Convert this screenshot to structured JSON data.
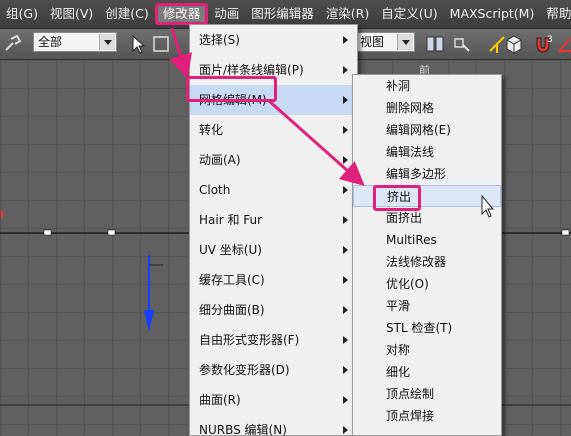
{
  "menubar": {
    "items": [
      {
        "label": "组(G)"
      },
      {
        "label": "视图(V)"
      },
      {
        "label": "创建(C)"
      },
      {
        "label": "修改器"
      },
      {
        "label": "动画"
      },
      {
        "label": "图形编辑器"
      },
      {
        "label": "渲染(R)"
      },
      {
        "label": "自定义(U)"
      },
      {
        "label": "MAXScript(M)"
      },
      {
        "label": "帮助"
      }
    ]
  },
  "toolbar": {
    "selection_filter": "全部",
    "view_combo": "视图"
  },
  "viewport": {
    "label": "前"
  },
  "modifier_menu": {
    "items": [
      {
        "label": "选择(S)"
      },
      {
        "label": "面片/样条线编辑(P)"
      },
      {
        "label": "网格编辑(M)"
      },
      {
        "label": "转化"
      },
      {
        "label": "动画(A)"
      },
      {
        "label": "Cloth"
      },
      {
        "label": "Hair 和 Fur"
      },
      {
        "label": "UV 坐标(U)"
      },
      {
        "label": "缓存工具(C)"
      },
      {
        "label": "细分曲面(B)"
      },
      {
        "label": "自由形式变形器(F)"
      },
      {
        "label": "参数化变形器(D)"
      },
      {
        "label": "曲面(R)"
      },
      {
        "label": "NURBS 编辑(N)"
      }
    ]
  },
  "mesh_edit_submenu": {
    "items": [
      {
        "label": "补洞"
      },
      {
        "label": "删除网格"
      },
      {
        "label": "编辑网格(E)"
      },
      {
        "label": "编辑法线"
      },
      {
        "label": "编辑多边形"
      },
      {
        "label": "挤出"
      },
      {
        "label": "面挤出"
      },
      {
        "label": "MultiRes"
      },
      {
        "label": "法线修改器"
      },
      {
        "label": "优化(O)"
      },
      {
        "label": "平滑"
      },
      {
        "label": "STL 检查(T)"
      },
      {
        "label": "对称"
      },
      {
        "label": "细化"
      },
      {
        "label": "顶点绘制"
      },
      {
        "label": "顶点焊接"
      }
    ]
  },
  "colors": {
    "annotation": "#e0207a",
    "menu_bg": "#f0f0f0",
    "highlight": "#c8d9f3"
  }
}
